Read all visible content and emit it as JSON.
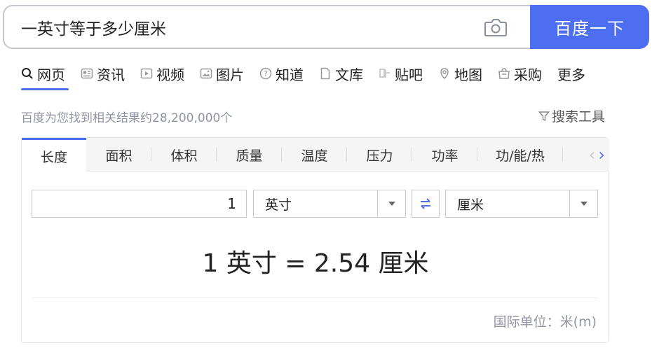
{
  "search": {
    "query": "一英寸等于多少厘米",
    "button_label": "百度一下"
  },
  "nav": {
    "items": [
      {
        "label": "网页",
        "icon": "search-icon"
      },
      {
        "label": "资讯",
        "icon": "news-icon"
      },
      {
        "label": "视频",
        "icon": "video-icon"
      },
      {
        "label": "图片",
        "icon": "image-icon"
      },
      {
        "label": "知道",
        "icon": "question-icon"
      },
      {
        "label": "文库",
        "icon": "doc-icon"
      },
      {
        "label": "贴吧",
        "icon": "tieba-icon"
      },
      {
        "label": "地图",
        "icon": "map-icon"
      },
      {
        "label": "采购",
        "icon": "shop-icon"
      },
      {
        "label": "更多",
        "icon": ""
      }
    ],
    "active_index": 0
  },
  "results": {
    "count_text": "百度为您找到相关结果约28,200,000个",
    "tools_label": "搜索工具"
  },
  "converter": {
    "tabs": [
      "长度",
      "面积",
      "体积",
      "质量",
      "温度",
      "压力",
      "功率",
      "功/能/热"
    ],
    "active_tab": 0,
    "input_value": "1",
    "from_unit": "英寸",
    "to_unit": "厘米",
    "result_text": "1 英寸 = 2.54 厘米",
    "base_unit_text": "国际单位：米(m)"
  },
  "colors": {
    "accent": "#4e6ef2",
    "muted_text": "#9195a3"
  }
}
